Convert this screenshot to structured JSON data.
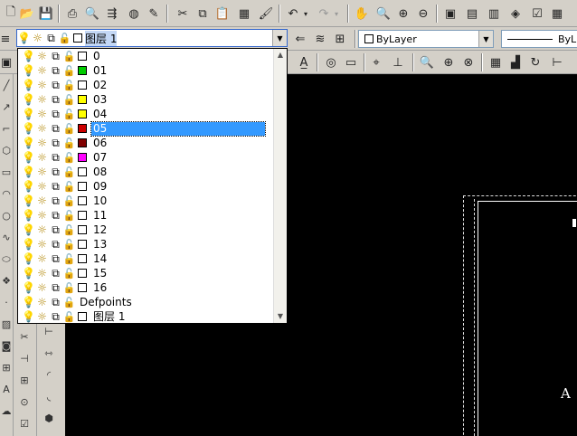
{
  "colors": {
    "canvas": "#000000",
    "selection": "#3399ff",
    "toolbar": "#d4d0c8"
  },
  "toolbar1": {
    "icons": [
      "new-icon",
      "open-icon",
      "save-icon",
      "print-icon",
      "print-preview-icon",
      "publish-icon",
      "3d-dwf-icon",
      "edit-icon",
      "cut-icon",
      "copy-icon",
      "paste-icon",
      "match-properties-icon",
      "undo-icon",
      "undo-dropdown-icon",
      "redo-icon",
      "redo-dropdown-icon",
      "pan-icon",
      "zoom-realtime-icon",
      "zoom-window-icon",
      "zoom-previous-icon",
      "properties-icon",
      "design-center-icon",
      "tool-palettes-icon",
      "sheet-set-icon",
      "markup-icon",
      "quickcalc-icon"
    ]
  },
  "layer_control": {
    "current_layer": "图层 1"
  },
  "linetype_control": {
    "value": "ByLayer"
  },
  "lineweight_control": {
    "value": "ByL"
  },
  "layers": [
    {
      "name": "0",
      "color": "#ffffff"
    },
    {
      "name": "01",
      "color": "#00cc00"
    },
    {
      "name": "02",
      "color": "#ffffff"
    },
    {
      "name": "03",
      "color": "#ffff00"
    },
    {
      "name": "04",
      "color": "#ffff00"
    },
    {
      "name": "05",
      "color": "#cc0000",
      "selected": true
    },
    {
      "name": "06",
      "color": "#800000"
    },
    {
      "name": "07",
      "color": "#ff00ff"
    },
    {
      "name": "08",
      "color": "#ffffff"
    },
    {
      "name": "09",
      "color": "#ffffff"
    },
    {
      "name": "10",
      "color": "#ffffff"
    },
    {
      "name": "11",
      "color": "#ffffff"
    },
    {
      "name": "12",
      "color": "#ffffff"
    },
    {
      "name": "13",
      "color": "#ffffff"
    },
    {
      "name": "14",
      "color": "#ffffff"
    },
    {
      "name": "15",
      "color": "#ffffff"
    },
    {
      "name": "16",
      "color": "#ffffff"
    },
    {
      "name": "Defpoints",
      "color": "#ffffff",
      "no_swatch": true
    },
    {
      "name": "图层 1",
      "color": "#ffffff"
    }
  ],
  "canvas": {
    "label": "A"
  }
}
